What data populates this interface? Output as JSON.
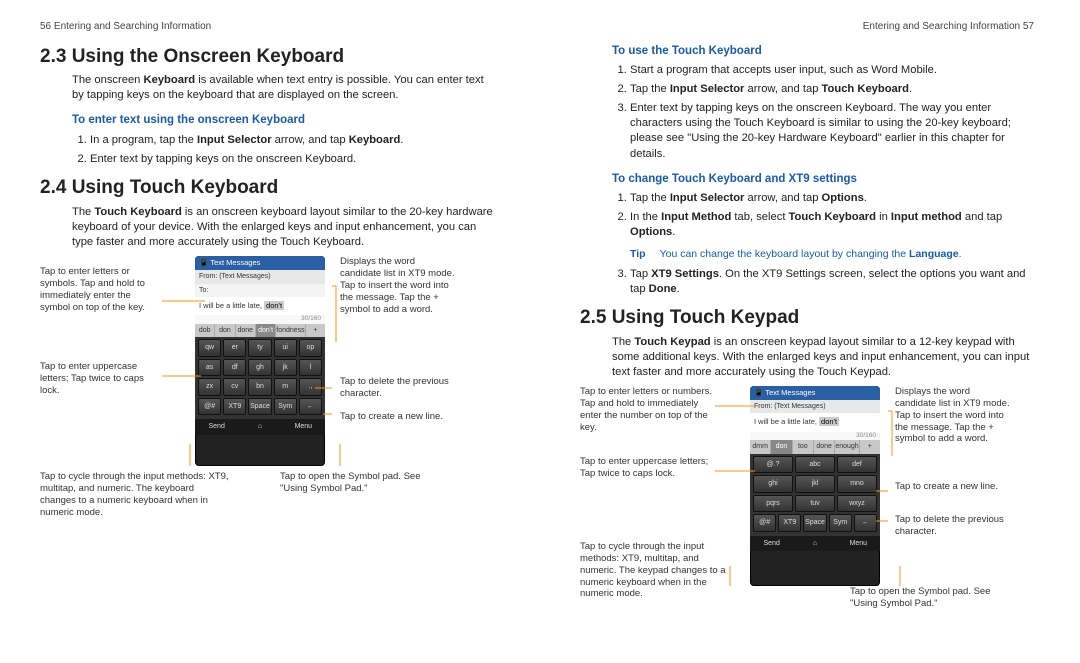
{
  "left": {
    "runhead": "56  Entering and Searching Information",
    "sec23_title": "2.3  Using the Onscreen Keyboard",
    "sec23_body_a": "The onscreen ",
    "sec23_body_b": "Keyboard",
    "sec23_body_c": " is available when text entry is possible. You can enter text by tapping keys on the keyboard that are displayed on the screen.",
    "sec23_sub": "To enter text using the onscreen Keyboard",
    "sec23_li1_a": "In a program, tap the ",
    "sec23_li1_b": "Input Selector",
    "sec23_li1_c": " arrow, and tap ",
    "sec23_li1_d": "Keyboard",
    "sec23_li1_e": ".",
    "sec23_li2": "Enter text by tapping keys on the onscreen Keyboard.",
    "sec24_title": "2.4  Using Touch Keyboard",
    "sec24_body_a": "The ",
    "sec24_body_b": "Touch Keyboard",
    "sec24_body_c": " is an onscreen keyboard layout similar to the 20-key hardware keyboard of your device. With the enlarged keys and input enhancement, you can type faster and more accurately using the Touch Keyboard.",
    "phone_title": "Text Messages",
    "phone_from": "From: (Text Messages)",
    "phone_to": "To:",
    "phone_msg": "I will be a little late, ",
    "phone_cand": "don't",
    "phone_counter": "30/160",
    "phone_pred": [
      "dob",
      "don",
      "done",
      "don't",
      "fondness",
      "+"
    ],
    "phone_rows20": [
      [
        "qw",
        "er",
        "ty",
        "ui",
        "op"
      ],
      [
        "as",
        "df",
        "gh",
        "jk",
        "l"
      ],
      [
        "zx",
        "cv",
        "bn",
        "m",
        ".,"
      ],
      [
        "@#",
        "XT9",
        "Space",
        "Sym",
        "←"
      ]
    ],
    "phone_bottom": [
      "Send",
      "⌂",
      "Menu"
    ],
    "callouts_left": {
      "c1": "Tap to enter letters or symbols. Tap and hold to immediately enter the symbol on top of the key.",
      "c2": "Tap to enter uppercase letters; Tap twice to caps lock.",
      "c3": "Tap to cycle through the input methods: XT9, multitap, and numeric. The keyboard changes to a numeric keyboard when in numeric mode.",
      "c4": "Displays the word candidate list in XT9 mode. Tap to insert the word into the message. Tap the + symbol to add a word.",
      "c5": "Tap to delete the previous character.",
      "c6": "Tap to create a new line.",
      "c7": "Tap to open the Symbol pad. See \"Using Symbol Pad.\""
    }
  },
  "right": {
    "runhead": "Entering and Searching Information  57",
    "subA": "To use the Touch Keyboard",
    "li1": "Start a program that accepts user input, such as Word Mobile.",
    "li2_a": "Tap the ",
    "li2_b": "Input Selector",
    "li2_c": " arrow, and tap ",
    "li2_d": "Touch Keyboard",
    "li2_e": ".",
    "li3": "Enter text by tapping keys on the onscreen Keyboard. The way you enter characters using the Touch Keyboard is similar to using the 20-key keyboard; please see \"Using the 20-key Hardware Keyboard\" earlier in this chapter for details.",
    "subB": "To change Touch Keyboard and XT9 settings",
    "liB1_a": "Tap the ",
    "liB1_b": "Input Selector",
    "liB1_c": " arrow, and tap ",
    "liB1_d": "Options",
    "liB1_e": ".",
    "liB2_a": "In the ",
    "liB2_b": "Input Method",
    "liB2_c": " tab, select ",
    "liB2_d": "Touch Keyboard",
    "liB2_e": " in ",
    "liB2_f": "Input method",
    "liB2_g": " and tap ",
    "liB2_h": "Options",
    "liB2_i": ".",
    "tip_label": "Tip",
    "tip_text_a": "You can change the keyboard layout by changing the ",
    "tip_text_b": "Language",
    "tip_text_c": ".",
    "liB3_a": "Tap ",
    "liB3_b": "XT9 Settings",
    "liB3_c": ". On the XT9 Settings screen, select the options you want and tap ",
    "liB3_d": "Done",
    "liB3_e": ".",
    "sec25_title": "2.5  Using Touch Keypad",
    "sec25_body_a": "The ",
    "sec25_body_b": "Touch Keypad",
    "sec25_body_c": " is an onscreen keypad layout similar to a 12-key keypad with some additional keys. With the enlarged keys and input enhancement, you can input text faster and more accurately using the Touch Keypad.",
    "phone_pred12": [
      "dmm",
      "don",
      "too",
      "done",
      "enough",
      "+"
    ],
    "phone_rows12": [
      [
        "@.?",
        "abc",
        "def"
      ],
      [
        "ghi",
        "jkl",
        "mno"
      ],
      [
        "pqrs",
        "tuv",
        "wxyz"
      ],
      [
        "@#",
        "XT9",
        "Space",
        "Sym",
        "←"
      ]
    ],
    "callouts_right": {
      "c1": "Tap to enter letters or numbers. Tap and hold to immediately enter the number on top of the key.",
      "c2": "Tap to enter uppercase letters; Tap twice to caps lock.",
      "c3": "Tap to cycle through the input methods: XT9, multitap, and numeric. The keypad changes to a numeric keyboard when in the numeric mode.",
      "c4": "Displays the word candidate list in XT9 mode. Tap to insert the word into the message. Tap the + symbol to add a word.",
      "c5": "Tap to create a new line.",
      "c6": "Tap to delete the previous character.",
      "c7": "Tap to open the Symbol pad. See \"Using Symbol Pad.\""
    }
  }
}
